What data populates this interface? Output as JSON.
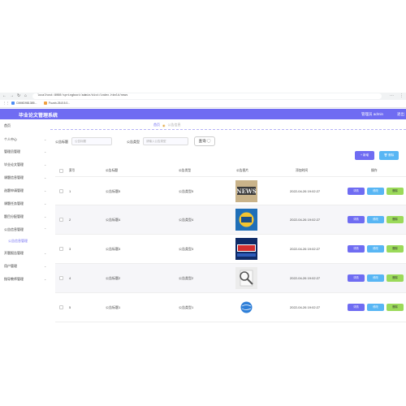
{
  "browser": {
    "url": "localhost:8080/springboot/admin/dist/index.html#/news",
    "bookmarks": [
      "CMMD981385...",
      "Fuzzb-26.8.5.0..."
    ]
  },
  "app": {
    "title": "毕业论文管理系统",
    "user_label": "管理员 admin",
    "logout_label": "退出"
  },
  "sidebar": {
    "items": [
      "首页",
      "个人中心",
      "管理员管理",
      "毕业论文管理",
      "课题信息管理",
      "选题申请管理",
      "课题任务管理",
      "题目分配管理",
      "公告信息管理",
      "公告信息管理",
      "开题报告管理",
      "用户管理",
      "指导教师管理"
    ]
  },
  "breadcrumb": {
    "home": "首页",
    "current": "公告信息"
  },
  "search": {
    "title_label": "公告标题",
    "title_placeholder": "公告标题",
    "type_label": "公告类型",
    "type_placeholder": "请输入公告类型",
    "button": "查询 ◯"
  },
  "toolbar": {
    "add": "+ 新增",
    "delete": "🗑 删除"
  },
  "table": {
    "headers": [
      "索引",
      "公告标题",
      "公告类型",
      "公告图片",
      "添加时间",
      "操作"
    ],
    "rows": [
      {
        "index": "1",
        "title": "公告标题5",
        "type": "公告类型5",
        "time": "2022-04-26 19:02:27",
        "image": "news"
      },
      {
        "index": "2",
        "title": "公告标题4",
        "type": "公告类型4",
        "time": "2022-04-26 19:02:27",
        "image": "badge"
      },
      {
        "index": "3",
        "title": "公告标题3",
        "type": "公告类型3",
        "time": "2022-04-26 19:02:27",
        "image": "finance"
      },
      {
        "index": "4",
        "title": "公告标题2",
        "type": "公告类型2",
        "time": "2022-04-26 19:02:27",
        "image": "magnifier"
      },
      {
        "index": "5",
        "title": "公告标题1",
        "type": "公告类型1",
        "time": "2022-04-26 19:02:27",
        "image": "globe"
      }
    ],
    "actions": {
      "view": "详情",
      "edit": "修改",
      "delete": "删除"
    }
  },
  "colors": {
    "accent": "#6f6cf2",
    "edit": "#58b6f4",
    "delete": "#9bda5a"
  }
}
